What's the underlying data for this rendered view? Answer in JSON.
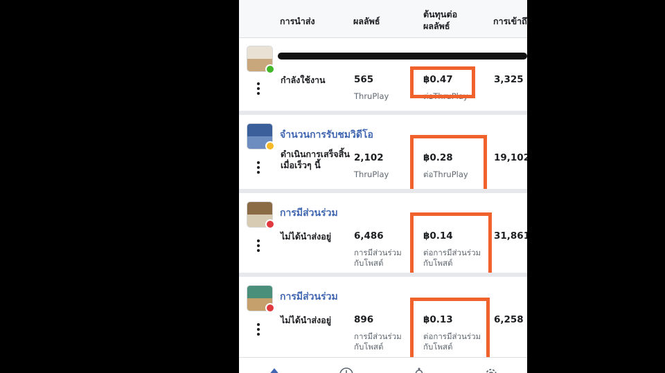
{
  "header": {
    "delivery": "การนำส่ง",
    "results": "ผลลัพธ์",
    "cost_per_result_1": "ต้นทุนต่อ",
    "cost_per_result_2": "ผลลัพธ์",
    "reach": "การเข้าถึ"
  },
  "campaigns": [
    {
      "name": "",
      "delivery": "กำลังใช้งาน",
      "results": "565",
      "result_type": "ThruPlay",
      "cost": "฿0.47",
      "cost_label": "ต่อThruPlay",
      "reach": "3,325",
      "status_color": "#42b72a"
    },
    {
      "name": "จำนวนการรับชมวิดีโอ",
      "delivery": "ดำเนินการเสร็จสิ้นเมื่อเร็วๆ นี้",
      "results": "2,102",
      "result_type": "ThruPlay",
      "cost": "฿0.28",
      "cost_label": "ต่อThruPlay",
      "reach": "19,102",
      "status_color": "#f7b928"
    },
    {
      "name": "การมีส่วนร่วม",
      "delivery": "ไม่ได้นำส่งอยู่",
      "results": "6,486",
      "result_type": "การมีส่วนร่วมกับโพสต์",
      "cost": "฿0.14",
      "cost_label": "ต่อการมีส่วนร่วมกับโพสต์",
      "reach": "31,861",
      "status_color": "#e0393e"
    },
    {
      "name": "การมีส่วนร่วม",
      "delivery": "ไม่ได้นำส่งอยู่",
      "results": "896",
      "result_type": "การมีส่วนร่วมกับโพสต์",
      "cost": "฿0.13",
      "cost_label": "ต่อการมีส่วนร่วมกับโพสต์",
      "reach": "6,258",
      "status_color": "#e0393e"
    }
  ],
  "colors": {
    "highlight": "#f0622b",
    "link": "#4267b2"
  },
  "tabbar": {
    "icons": [
      "home-icon",
      "clock-icon",
      "bell-icon",
      "gear-icon"
    ]
  }
}
